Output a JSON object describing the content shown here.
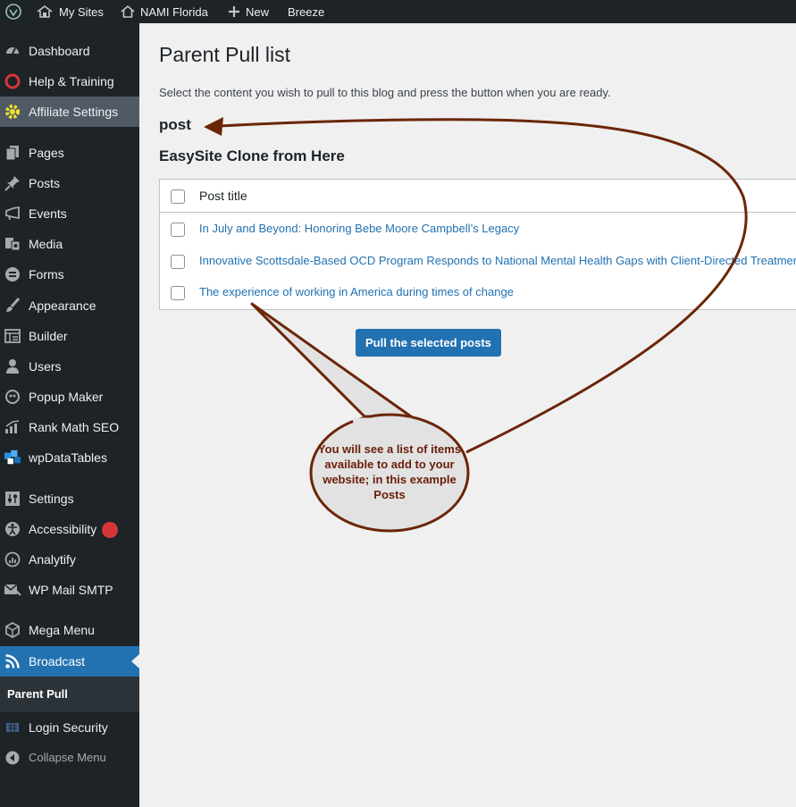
{
  "adminbar": {
    "my_sites": "My Sites",
    "site_name": "NAMI Florida",
    "new_label": "New",
    "breeze": "Breeze"
  },
  "sidebar": {
    "items": [
      {
        "label": "Dashboard",
        "icon": "dashboard-icon"
      },
      {
        "label": "Help & Training",
        "icon": "lifebuoy-icon"
      },
      {
        "label": "Affiliate Settings",
        "icon": "gear-icon"
      },
      {
        "label": "Pages",
        "icon": "pages-icon"
      },
      {
        "label": "Posts",
        "icon": "pin-icon"
      },
      {
        "label": "Events",
        "icon": "megaphone-icon"
      },
      {
        "label": "Media",
        "icon": "media-icon"
      },
      {
        "label": "Forms",
        "icon": "forms-icon"
      },
      {
        "label": "Appearance",
        "icon": "brush-icon"
      },
      {
        "label": "Builder",
        "icon": "builder-icon"
      },
      {
        "label": "Users",
        "icon": "user-icon"
      },
      {
        "label": "Popup Maker",
        "icon": "popup-icon"
      },
      {
        "label": "Rank Math SEO",
        "icon": "chart-icon"
      },
      {
        "label": "wpDataTables",
        "icon": "table-icon"
      },
      {
        "label": "Settings",
        "icon": "settings-icon"
      },
      {
        "label": "Accessibility",
        "icon": "accessibility-icon"
      },
      {
        "label": "Analytify",
        "icon": "analytics-icon"
      },
      {
        "label": "WP Mail SMTP",
        "icon": "mail-icon"
      },
      {
        "label": "Mega Menu",
        "icon": "megamenu-icon"
      },
      {
        "label": "Broadcast",
        "icon": "rss-icon"
      },
      {
        "label": "Login Security",
        "icon": "shield-icon"
      },
      {
        "label": "Collapse Menu",
        "icon": "collapse-icon"
      }
    ],
    "submenu_current": "Parent Pull"
  },
  "main": {
    "title": "Parent Pull list",
    "intro": "Select the content you wish to pull to this blog and press the button when you are ready.",
    "section_type": "post",
    "section_clone": "EasySite Clone from Here",
    "table_header": "Post title",
    "posts": [
      "In July and Beyond: Honoring Bebe Moore Campbell’s Legacy",
      "Innovative Scottsdale-Based OCD Program Responds to National Mental Health Gaps with Client-Directed Treatment",
      "The experience of working in America during times of change"
    ],
    "button": "Pull the selected posts"
  },
  "annotation": {
    "callout": "You will see a list of items available to add to your website; in this example Posts"
  },
  "colors": {
    "sidebar_bg": "#1d2327",
    "accent": "#2271b1",
    "annotation_stroke": "#6b2608"
  }
}
